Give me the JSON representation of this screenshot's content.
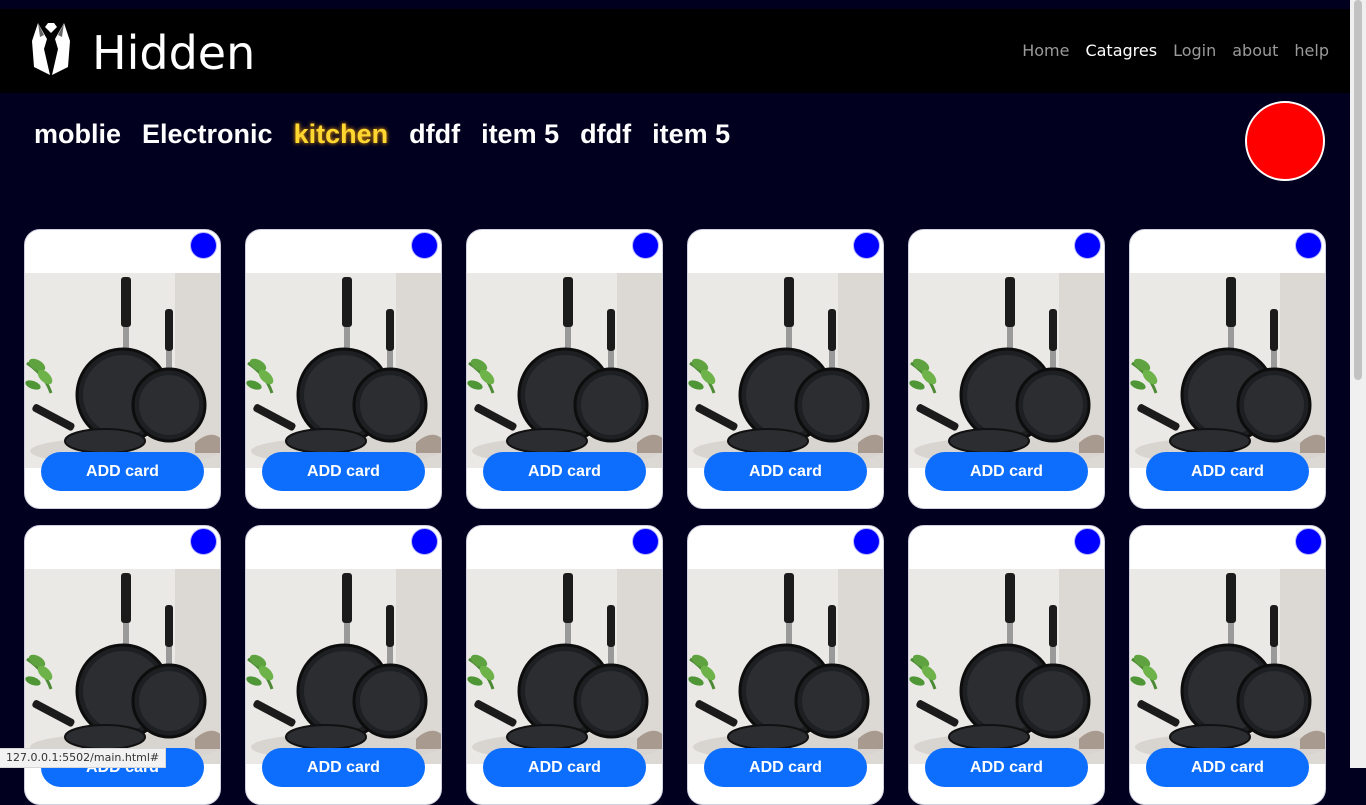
{
  "header": {
    "brand": "Hidden",
    "nav": [
      {
        "label": "Home",
        "active": false
      },
      {
        "label": "Catagres",
        "active": true
      },
      {
        "label": "Login",
        "active": false
      },
      {
        "label": "about",
        "active": false
      },
      {
        "label": "help",
        "active": false
      }
    ]
  },
  "categories": [
    {
      "label": "moblie",
      "active": false
    },
    {
      "label": "Electronic",
      "active": false
    },
    {
      "label": "kitchen",
      "active": true
    },
    {
      "label": "dfdf",
      "active": false
    },
    {
      "label": "item 5",
      "active": false
    },
    {
      "label": "dfdf",
      "active": false
    },
    {
      "label": "item 5",
      "active": false
    }
  ],
  "product_cards": [
    {
      "button": "ADD card",
      "image": "pan-set-image"
    },
    {
      "button": "ADD card",
      "image": "pan-set-image"
    },
    {
      "button": "ADD card",
      "image": "pan-set-image"
    },
    {
      "button": "ADD card",
      "image": "pan-set-image"
    },
    {
      "button": "ADD card",
      "image": "pan-set-image"
    },
    {
      "button": "ADD card",
      "image": "pan-set-image"
    },
    {
      "button": "ADD card",
      "image": "pan-set-image"
    },
    {
      "button": "ADD card",
      "image": "pan-set-image"
    },
    {
      "button": "ADD card",
      "image": "pan-set-image"
    },
    {
      "button": "ADD card",
      "image": "pan-set-image"
    },
    {
      "button": "ADD card",
      "image": "pan-set-image"
    },
    {
      "button": "ADD card",
      "image": "pan-set-image"
    }
  ],
  "status_url": "127.0.0.1:5502/main.html#",
  "colors": {
    "page_bg": "#01001f",
    "navbar_bg": "#000000",
    "active_category": "#ffd731",
    "button_blue": "#0d6efd",
    "card_dot": "#0000ff",
    "profile_circle": "#ff0000"
  }
}
